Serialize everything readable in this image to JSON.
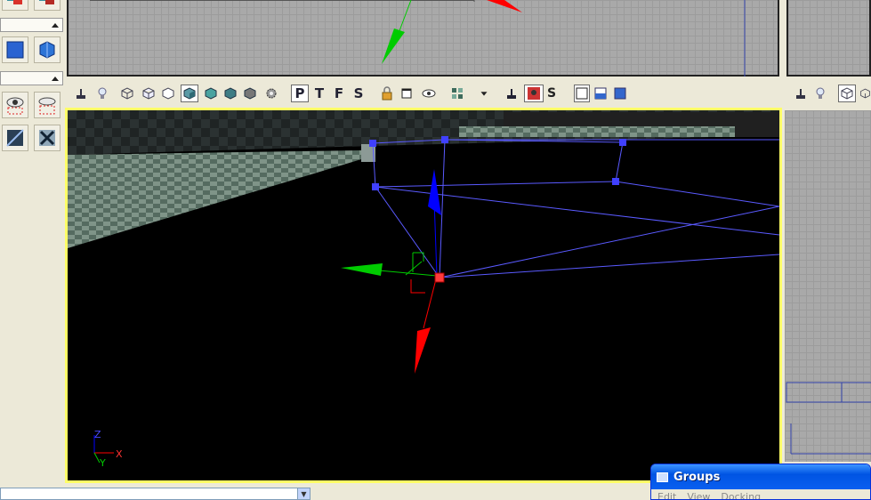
{
  "viewport_toolbar": {
    "view_letters": [
      "P",
      "T",
      "F",
      "S"
    ],
    "active_view": "P",
    "extra_label": "S"
  },
  "perspective_viewport": {
    "axis_indicator": {
      "z_label": "Z",
      "x_label": "X",
      "y_label": "Y"
    }
  },
  "groups_window": {
    "title": "Groups",
    "menu": [
      "Edit",
      "View",
      "Docking"
    ]
  },
  "bottom_dropdown": {
    "value": ""
  },
  "colors": {
    "active_viewport_border": "#ffff66",
    "selection_wire": "#5a5aff",
    "pivot": "#ff3b3b",
    "gizmo_x": "#ff0000",
    "gizmo_y": "#00cc00",
    "gizmo_z": "#0000ff"
  }
}
